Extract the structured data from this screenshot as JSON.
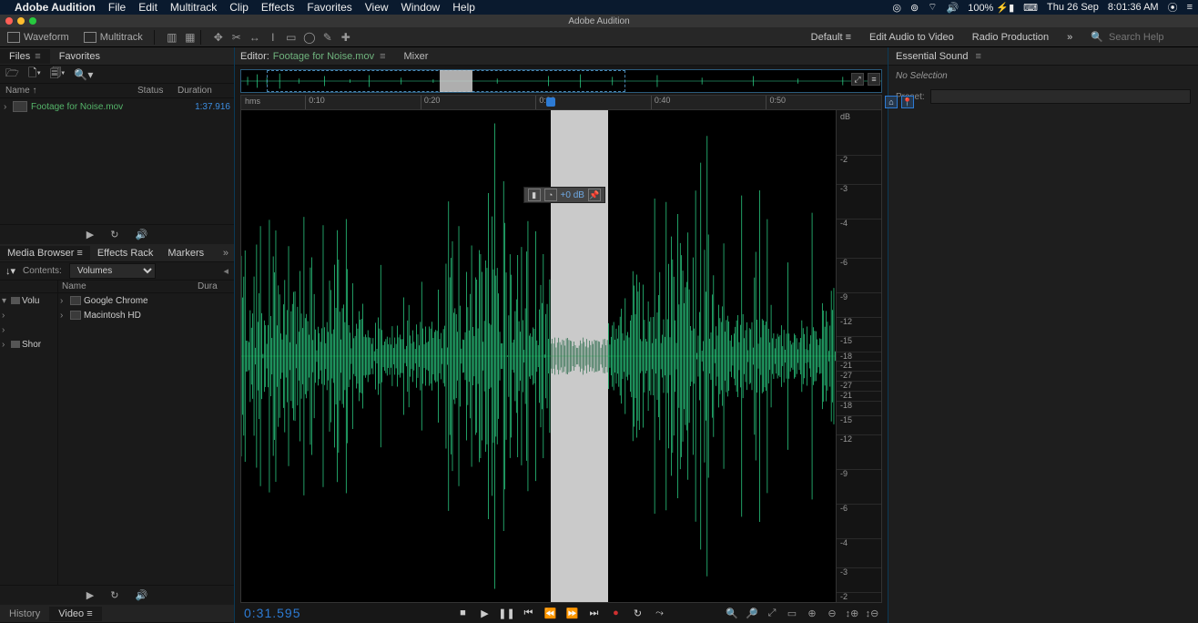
{
  "menubar": {
    "app_name": "Adobe Audition",
    "items": [
      "File",
      "Edit",
      "Multitrack",
      "Clip",
      "Effects",
      "Favorites",
      "View",
      "Window",
      "Help"
    ],
    "right": {
      "battery": "100%",
      "date": "Thu 26 Sep",
      "time": "8:01:36 AM"
    }
  },
  "titlebar": {
    "title": "Adobe Audition"
  },
  "toolbar": {
    "waveform_label": "Waveform",
    "multitrack_label": "Multitrack",
    "workspaces": {
      "default": "Default",
      "edit_av": "Edit Audio to Video",
      "radio": "Radio Production"
    },
    "search_placeholder": "Search Help"
  },
  "files_panel": {
    "tabs": {
      "files": "Files",
      "favorites": "Favorites"
    },
    "columns": {
      "name": "Name ↑",
      "status": "Status",
      "duration": "Duration"
    },
    "file": {
      "name": "Footage for Noise.mov",
      "duration": "1:37.916"
    }
  },
  "media_panel": {
    "tabs": {
      "media": "Media Browser",
      "effects": "Effects Rack",
      "markers": "Markers"
    },
    "contents_label": "Contents:",
    "contents_value": "Volumes",
    "tree_items": [
      "Volu",
      "Shor"
    ],
    "list_head": {
      "name": "Name",
      "dura": "Dura"
    },
    "list_items": [
      "Google Chrome",
      "Macintosh HD"
    ]
  },
  "bottom_tabs": {
    "history": "History",
    "video": "Video"
  },
  "editor": {
    "panel_label": "Editor:",
    "file_name": "Footage for Noise.mov",
    "mixer_tab": "Mixer",
    "ruler_unit": "hms",
    "ticks": [
      "0:10",
      "0:20",
      "0:30",
      "0:40",
      "0:50"
    ],
    "playhead_pct": 48.3,
    "selection_pct": {
      "start": 48.3,
      "end": 57.3
    },
    "overview_range_pct": {
      "start": 4,
      "end": 60
    },
    "hud": {
      "gain": "+0 dB"
    },
    "db_unit": "dB",
    "db_labels": [
      {
        "v": "-2",
        "p": 9
      },
      {
        "v": "-3",
        "p": 15
      },
      {
        "v": "-4",
        "p": 22
      },
      {
        "v": "-6",
        "p": 30
      },
      {
        "v": "-9",
        "p": 37
      },
      {
        "v": "-12",
        "p": 42
      },
      {
        "v": "-15",
        "p": 46
      },
      {
        "v": "-18",
        "p": 49
      },
      {
        "v": "-21",
        "p": 51
      },
      {
        "v": "-27",
        "p": 53
      },
      {
        "v": "-27",
        "p": 55
      },
      {
        "v": "-21",
        "p": 57
      },
      {
        "v": "-18",
        "p": 59
      },
      {
        "v": "-15",
        "p": 62
      },
      {
        "v": "-12",
        "p": 66
      },
      {
        "v": "-9",
        "p": 73
      },
      {
        "v": "-6",
        "p": 80
      },
      {
        "v": "-4",
        "p": 87
      },
      {
        "v": "-3",
        "p": 93
      },
      {
        "v": "-2",
        "p": 98
      }
    ],
    "timecode": "0:31.595"
  },
  "essential_sound": {
    "title": "Essential Sound",
    "no_selection": "No Selection",
    "preset_label": "Preset:"
  }
}
